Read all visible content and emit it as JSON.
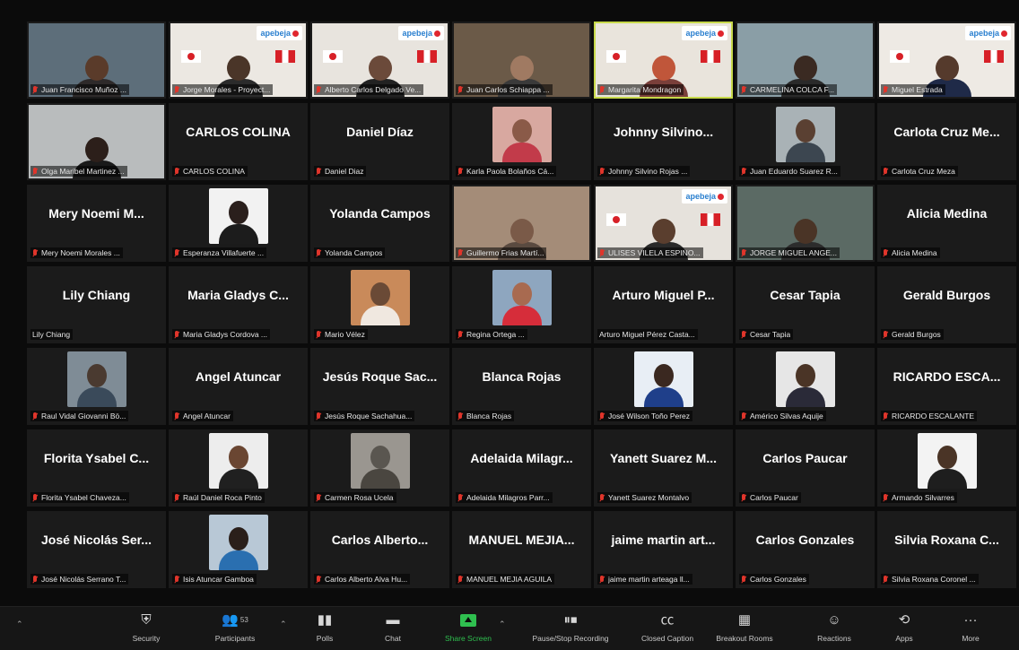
{
  "tiles": [
    {
      "type": "video",
      "label": "Juan Francisco Muñoz ...",
      "bg": "#5d6e7a",
      "head": "#5a3b2a",
      "body": "#2e2a2a"
    },
    {
      "type": "video-logo",
      "label": "Jorge Morales - Proyect...",
      "bg": "#ece8e2",
      "head": "#4a3528",
      "body": "#2b2b2b",
      "flags": "pe-jp",
      "logo": "apebeja"
    },
    {
      "type": "video-logo",
      "label": "Alberto Carlos Delgado Ve...",
      "bg": "#e8e4de",
      "head": "#6b4a3a",
      "body": "#222222",
      "flags": "pe-jp",
      "logo": "apebeja"
    },
    {
      "type": "video",
      "label": "Juan Carlos Schiappa ...",
      "bg": "#6b5a48",
      "head": "#a07a62",
      "body": "#3a3a3a"
    },
    {
      "type": "video-logo",
      "label": "Margarita Mondragon",
      "bg": "#e9e4dc",
      "head": "#c0563a",
      "body": "#7a3f3a",
      "flags": "pe-jp",
      "logo": "apebeja",
      "active": true
    },
    {
      "type": "video",
      "label": "CARMELINA COLCA F...",
      "bg": "#8a9ea6",
      "head": "#3a2a22",
      "body": "#2a2a2a"
    },
    {
      "type": "video-logo",
      "label": "Miguel Estrada",
      "bg": "#eeeae4",
      "head": "#553a2c",
      "body": "#1f2a48",
      "flags": "pe-jp",
      "logo": "apebeja"
    },
    {
      "type": "video",
      "label": "Olga Maribel Martinez ...",
      "bg": "#b9bcbd",
      "head": "#2c1f1a",
      "body": "#1a1a1a"
    },
    {
      "type": "name",
      "big": "CARLOS COLINA",
      "label": "CARLOS COLINA"
    },
    {
      "type": "name",
      "big": "Daniel Díaz",
      "label": "Daniel Diaz"
    },
    {
      "type": "photo",
      "label": "Karla Paola Bolaños Cá...",
      "photo": "#d8a8a0",
      "head": "#8a5a48",
      "body": "#c23b4a"
    },
    {
      "type": "name",
      "big": "Johnny Silvino...",
      "label": "Johnny Silvino Rojas ..."
    },
    {
      "type": "photo",
      "label": "Juan Eduardo Suarez R...",
      "photo": "#a9b2b6",
      "head": "#5a4032",
      "body": "#3c4650"
    },
    {
      "type": "name",
      "big": "Carlota Cruz Me...",
      "label": "Carlota Cruz Meza"
    },
    {
      "type": "name",
      "big": "Mery Noemi M...",
      "label": "Mery Noemi Morales ..."
    },
    {
      "type": "photo",
      "label": "Esperanza Villafuerte ...",
      "photo": "#f2f2f2",
      "head": "#2a1f1c",
      "body": "#1c1c1c"
    },
    {
      "type": "name",
      "big": "Yolanda Campos",
      "label": "Yolanda Campos"
    },
    {
      "type": "video",
      "label": "Guillermo Frias Martí...",
      "bg": "#a48c78",
      "head": "#7a5a48",
      "body": "#5a4a40"
    },
    {
      "type": "video-logo",
      "label": "ULISES VILELA ESPINO...",
      "bg": "#e6e2dc",
      "head": "#5a3e2e",
      "body": "#2a2a2a",
      "flags": "pe-jp",
      "logo": "apebeja"
    },
    {
      "type": "video",
      "label": "JORGE MIGUEL ANGE...",
      "bg": "#5b6a64",
      "head": "#4a3426",
      "body": "#2c2c2c"
    },
    {
      "type": "name",
      "big": "Alicia Medina",
      "label": "Alicia Medina"
    },
    {
      "type": "name",
      "big": "Lily Chiang",
      "label": "Lily Chiang",
      "nomute": true
    },
    {
      "type": "name",
      "big": "Maria Gladys C...",
      "label": "Maria Gladys Cordova ..."
    },
    {
      "type": "photo",
      "label": "Mario Vélez",
      "photo": "#c98a5a",
      "head": "#6a4a36",
      "body": "#f0e8e0"
    },
    {
      "type": "photo",
      "label": "Regina Ortega ...",
      "photo": "#8ea6bf",
      "head": "#a86a50",
      "body": "#d62d3a"
    },
    {
      "type": "name",
      "big": "Arturo Miguel P...",
      "label": "Arturo Miguel Pérez Casta...",
      "nomute": true
    },
    {
      "type": "name",
      "big": "Cesar Tapia",
      "label": "Cesar Tapia"
    },
    {
      "type": "name",
      "big": "Gerald Burgos",
      "label": "Gerald Burgos"
    },
    {
      "type": "photo",
      "label": "Raul Vidal Giovanni Bö...",
      "photo": "#7f8c96",
      "head": "#4a3a30",
      "body": "#3a4a5a"
    },
    {
      "type": "name",
      "big": "Angel Atuncar",
      "label": "Angel Atuncar"
    },
    {
      "type": "name",
      "big": "Jesús Roque Sac...",
      "label": "Jesús Roque Sachahua..."
    },
    {
      "type": "name",
      "big": "Blanca Rojas",
      "label": "Blanca Rojas"
    },
    {
      "type": "photo",
      "label": "José Wilson Toño Perez",
      "photo": "#e8eef5",
      "head": "#3a2820",
      "body": "#1f3f8a"
    },
    {
      "type": "photo",
      "label": "Américo Silvas Aquije",
      "photo": "#e6e6e6",
      "head": "#4a3426",
      "body": "#2a2a38"
    },
    {
      "type": "name",
      "big": "RICARDO ESCA...",
      "label": "RICARDO ESCALANTE"
    },
    {
      "type": "name",
      "big": "Florita Ysabel C...",
      "label": "Florita Ysabel Chaveza..."
    },
    {
      "type": "photo",
      "label": "Raúl Daniel Roca Pinto",
      "photo": "#ededed",
      "head": "#6a4632",
      "body": "#202020"
    },
    {
      "type": "photo",
      "label": "Carmen Rosa Ucela",
      "photo": "#9a9690",
      "head": "#5a5650",
      "body": "#4a4640"
    },
    {
      "type": "name",
      "big": "Adelaida Milagr...",
      "label": "Adelaida Milagros Parr..."
    },
    {
      "type": "name",
      "big": "Yanett Suarez M...",
      "label": "Yanett Suarez Montalvo"
    },
    {
      "type": "name",
      "big": "Carlos Paucar",
      "label": "Carlos Paucar"
    },
    {
      "type": "photo",
      "label": "Armando Silvarres",
      "photo": "#f3f3f3",
      "head": "#4a3426",
      "body": "#1e1e1e"
    },
    {
      "type": "name",
      "big": "José Nicolás Ser...",
      "label": "José Nicolás Serrano T..."
    },
    {
      "type": "photo",
      "label": "Isis Atuncar Gamboa",
      "photo": "#b8c8d6",
      "head": "#2a1f1a",
      "body": "#2a6fb0"
    },
    {
      "type": "name",
      "big": "Carlos Alberto...",
      "label": "Carlos Alberto Alva Hu..."
    },
    {
      "type": "name",
      "big": "MANUEL MEJIA...",
      "label": "MANUEL MEJIA AGUILA"
    },
    {
      "type": "name",
      "big": "jaime martin art...",
      "label": "jaime martin arteaga ll..."
    },
    {
      "type": "name",
      "big": "Carlos Gonzales",
      "label": "Carlos Gonzales"
    },
    {
      "type": "name",
      "big": "Silvia Roxana C...",
      "label": "Silvia Roxana Coronel ..."
    }
  ],
  "toolbar": {
    "security": "Security",
    "participants": "Participants",
    "participants_count": "53",
    "polls": "Polls",
    "chat": "Chat",
    "share": "Share Screen",
    "recording": "Pause/Stop Recording",
    "captions": "Closed Caption",
    "breakout": "Breakout Rooms",
    "reactions": "Reactions",
    "apps": "Apps",
    "more": "More"
  },
  "colors": {
    "share_green": "#2fbf4f",
    "mute_red": "#e0352b",
    "active_speaker_border": "#c7d94a",
    "tile_bg": "#1b1b1b"
  }
}
